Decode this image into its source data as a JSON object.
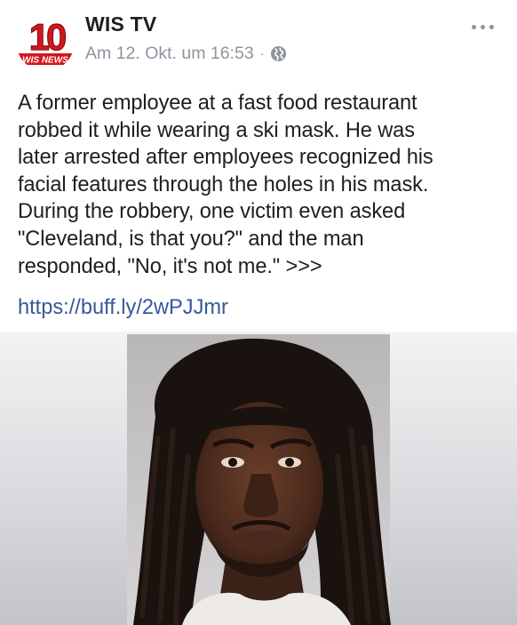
{
  "post": {
    "page_name": "WIS TV",
    "timestamp": "Am 12. Okt. um 16:53",
    "separator": "·",
    "privacy_icon": "globe-icon",
    "more_icon": "more-dots-icon",
    "avatar": {
      "logo_number": "10",
      "logo_text": "WIS NEWS",
      "accent_color": "#d4161c"
    },
    "text_lines": [
      "A former employee at a fast food restaurant",
      "robbed it while wearing a ski mask. He was",
      "later arrested after employees recognized his",
      "facial features through the holes in his mask.",
      "During the robbery, one victim even asked",
      "\"Cleveland, is that you?\" and the man",
      "responded, \"No, it's not me.\" >>>"
    ],
    "link": "https://buff.ly/2wPJJmr",
    "link_color": "#365899",
    "image": {
      "subject": "mugshot photo of a man with dreadlocks"
    }
  }
}
